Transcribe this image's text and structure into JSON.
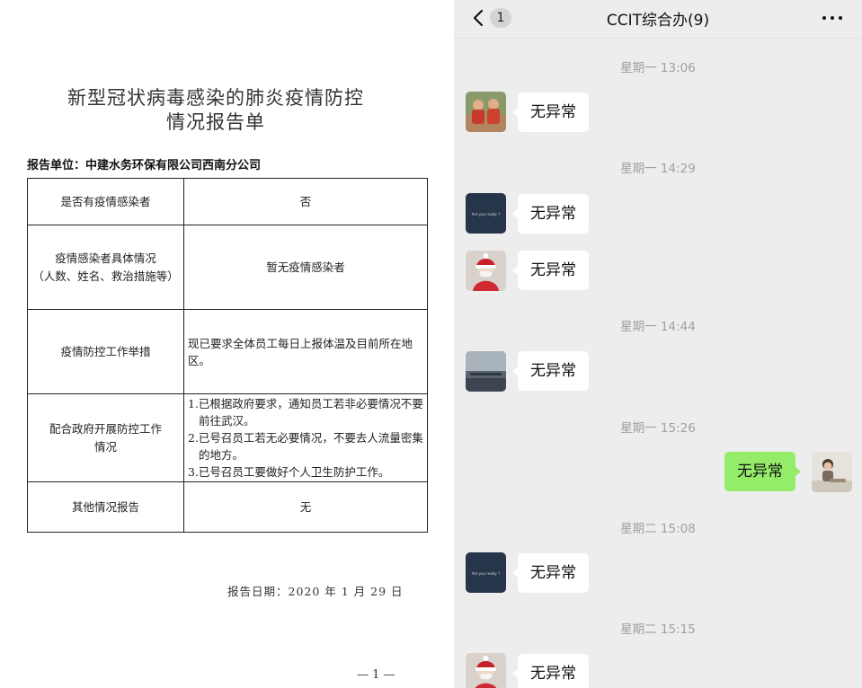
{
  "document": {
    "title_line1": "新型冠状病毒感染的肺炎疫情防控",
    "title_line2": "情况报告单",
    "unit": "报告单位：中建水务环保有限公司西南分公司",
    "rows": [
      {
        "label": "是否有疫情感染者",
        "value": "否"
      },
      {
        "label_line1": "疫情感染者具体情况",
        "label_line2": "（人数、姓名、救治措施等）",
        "value": "暂无疫情感染者"
      },
      {
        "label": "疫情防控工作举措",
        "value": "现已要求全体员工每日上报体温及目前所在地区。"
      },
      {
        "label_line1": "配合政府开展防控工作",
        "label_line2": "情况",
        "items": [
          "1.已根据政府要求，通知员工若非必要情况不要前往武汉。",
          "2.已号召员工若无必要情况，不要去人流量密集的地方。",
          "3.已号召员工要做好个人卫生防护工作。"
        ]
      },
      {
        "label": "其他情况报告",
        "value": "无"
      }
    ],
    "date": "报告日期：2020 年 1 月 29 日",
    "page": "— 1 —"
  },
  "chat": {
    "title": "CCIT综合办(9)",
    "back_count": "1",
    "avatar_small_text": "Are you ready ?",
    "icons": {
      "back": "chevron-left-icon",
      "more": "more-dots-icon"
    },
    "colors": {
      "background": "#ededed",
      "bubble_in": "#ffffff",
      "bubble_out": "#95ec69",
      "timestamp": "#a0a0a0"
    },
    "timestamps": [
      "星期一 13:06",
      "星期一 14:29",
      "星期一 14:44",
      "星期一 15:26",
      "星期二 15:08",
      "星期二 15:15"
    ],
    "messages": [
      {
        "text": "无异常",
        "direction": "incoming",
        "avatar": "kids-photo"
      },
      {
        "text": "无异常",
        "direction": "incoming",
        "avatar": "dark-text"
      },
      {
        "text": "无异常",
        "direction": "incoming",
        "avatar": "child-red"
      },
      {
        "text": "无异常",
        "direction": "incoming",
        "avatar": "landscape"
      },
      {
        "text": "无异常",
        "direction": "outgoing",
        "avatar": "child-sitting"
      },
      {
        "text": "无异常",
        "direction": "incoming",
        "avatar": "dark-text"
      },
      {
        "text": "无异常",
        "direction": "incoming",
        "avatar": "child-red"
      }
    ]
  }
}
